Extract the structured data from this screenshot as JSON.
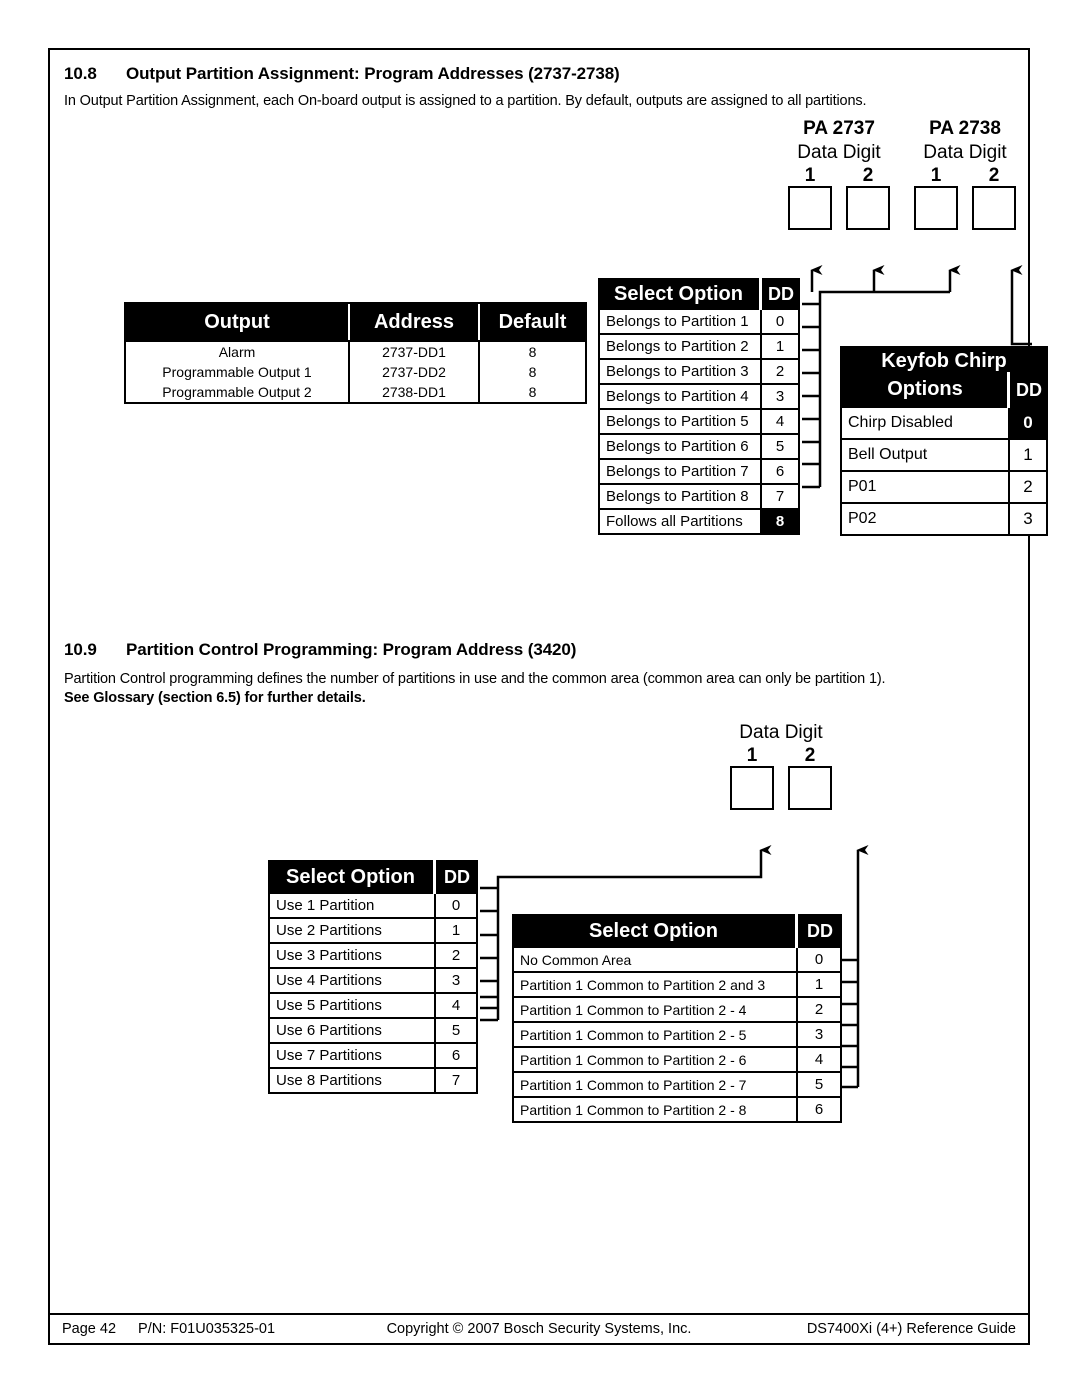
{
  "page": {
    "section_108": {
      "number": "10.8",
      "title": "Output Partition Assignment: Program Addresses (2737-2738)",
      "intro": "In Output Partition Assignment, each On-board output is assigned to a partition. By default, outputs are assigned to all partitions."
    },
    "section_109": {
      "number": "10.9",
      "title": "Partition Control Programming: Program Address (3420)",
      "intro": "Partition Control programming defines the number of partitions in use and the common area (common area can only be partition 1).",
      "intro_bold": "See Glossary (section 6.5) for further details."
    }
  },
  "output_table": {
    "headers": [
      "Output",
      "Address",
      "Default"
    ],
    "rows": [
      {
        "output": "Alarm",
        "address": "2737-DD1",
        "default": "8"
      },
      {
        "output": "Programmable Output 1",
        "address": "2737-DD2",
        "default": "8"
      },
      {
        "output": "Programmable Output 2",
        "address": "2738-DD1",
        "default": "8"
      }
    ]
  },
  "select_option_partition": {
    "header_label": "Select Option",
    "header_dd": "DD",
    "rows": [
      {
        "label": "Belongs to Partition 1",
        "dd": "0",
        "highlight": false
      },
      {
        "label": "Belongs to Partition 2",
        "dd": "1",
        "highlight": false
      },
      {
        "label": "Belongs to Partition 3",
        "dd": "2",
        "highlight": false
      },
      {
        "label": "Belongs to Partition 4",
        "dd": "3",
        "highlight": false
      },
      {
        "label": "Belongs to Partition 5",
        "dd": "4",
        "highlight": false
      },
      {
        "label": "Belongs to Partition 6",
        "dd": "5",
        "highlight": false
      },
      {
        "label": "Belongs to Partition 7",
        "dd": "6",
        "highlight": false
      },
      {
        "label": "Belongs to Partition 8",
        "dd": "7",
        "highlight": false
      },
      {
        "label": "Follows all Partitions",
        "dd": "8",
        "highlight": true
      }
    ]
  },
  "keyfob_chirp": {
    "title_line1": "Keyfob Chirp",
    "title_line2": "Options",
    "header_dd": "DD",
    "rows": [
      {
        "label": "Chirp Disabled",
        "dd": "0",
        "highlight": true
      },
      {
        "label": "Bell Output",
        "dd": "1",
        "highlight": false
      },
      {
        "label": "P01",
        "dd": "2",
        "highlight": false
      },
      {
        "label": "P02",
        "dd": "3",
        "highlight": false
      }
    ]
  },
  "pa_groups": [
    {
      "title": "PA 2737",
      "subtitle": "Data Digit",
      "digits": [
        "1",
        "2"
      ]
    },
    {
      "title": "PA 2738",
      "subtitle": "Data Digit",
      "digits": [
        "1",
        "2"
      ]
    }
  ],
  "pa_group_109": {
    "subtitle": "Data Digit",
    "digits": [
      "1",
      "2"
    ]
  },
  "select_option_use_partitions": {
    "header_label": "Select Option",
    "header_dd": "DD",
    "rows": [
      {
        "label": "Use 1  Partition",
        "dd": "0"
      },
      {
        "label": "Use 2  Partitions",
        "dd": "1"
      },
      {
        "label": "Use 3  Partitions",
        "dd": "2"
      },
      {
        "label": "Use 4  Partitions",
        "dd": "3"
      },
      {
        "label": "Use 5  Partitions",
        "dd": "4"
      },
      {
        "label": "Use 6  Partitions",
        "dd": "5"
      },
      {
        "label": "Use 7  Partitions",
        "dd": "6"
      },
      {
        "label": "Use 8  Partitions",
        "dd": "7"
      }
    ]
  },
  "select_option_common": {
    "header_label": "Select Option",
    "header_dd": "DD",
    "rows": [
      {
        "label": "No Common Area",
        "dd": "0"
      },
      {
        "label": "Partition 1 Common to Partition 2 and 3",
        "dd": "1"
      },
      {
        "label": "Partition 1 Common to Partition 2 - 4",
        "dd": "2"
      },
      {
        "label": "Partition 1 Common to Partition 2 - 5",
        "dd": "3"
      },
      {
        "label": "Partition 1 Common to Partition 2 - 6",
        "dd": "4"
      },
      {
        "label": "Partition 1 Common to Partition 2 - 7",
        "dd": "5"
      },
      {
        "label": "Partition 1 Common to Partition 2 - 8",
        "dd": "6"
      }
    ]
  },
  "footer": {
    "page": "Page 42",
    "part_number": "P/N: F01U035325-01",
    "copyright": "Copyright © 2007 Bosch Security Systems, Inc.",
    "guide": "DS7400Xi (4+) Reference Guide"
  },
  "colors": {
    "ink": "#000000",
    "paper": "#ffffff"
  }
}
